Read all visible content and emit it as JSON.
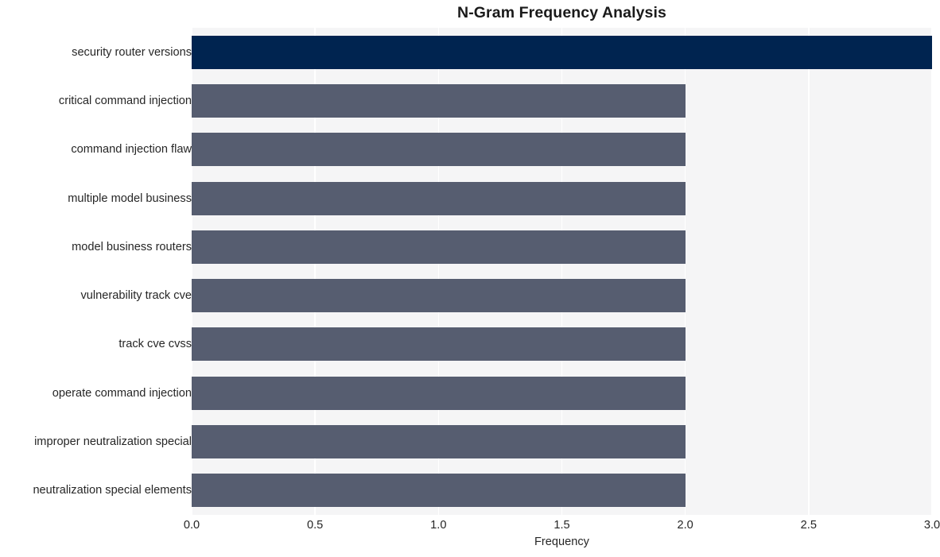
{
  "chart_data": {
    "type": "bar",
    "orientation": "horizontal",
    "title": "N-Gram Frequency Analysis",
    "xlabel": "Frequency",
    "ylabel": "",
    "xlim": [
      0.0,
      3.0
    ],
    "xticks": [
      "0.0",
      "0.5",
      "1.0",
      "1.5",
      "2.0",
      "2.5",
      "3.0"
    ],
    "xtick_values": [
      0.0,
      0.5,
      1.0,
      1.5,
      2.0,
      2.5,
      3.0
    ],
    "grid": true,
    "grid_axis": "x",
    "legend": "none",
    "categories": [
      "security router versions",
      "critical command injection",
      "command injection flaw",
      "multiple model business",
      "model business routers",
      "vulnerability track cve",
      "track cve cvss",
      "operate command injection",
      "improper neutralization special",
      "neutralization special elements"
    ],
    "values": [
      3,
      2,
      2,
      2,
      2,
      2,
      2,
      2,
      2,
      2
    ],
    "bar_colors": [
      "#002450",
      "#565d70",
      "#565d70",
      "#565d70",
      "#565d70",
      "#565d70",
      "#565d70",
      "#565d70",
      "#565d70",
      "#565d70"
    ]
  },
  "style": {
    "plot_background": "#f5f5f6",
    "figure_background": "#ffffff",
    "gridline_color": "#ffffff",
    "text_color": "#262626",
    "title_color": "#1a1a1a",
    "highlight_color": "#002450",
    "bar_color": "#565d70"
  }
}
